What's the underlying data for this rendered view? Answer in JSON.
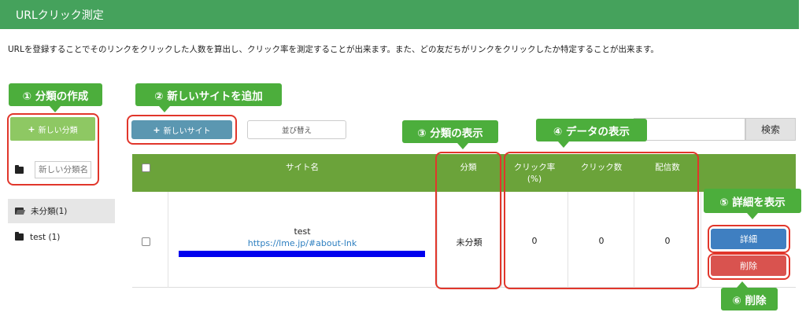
{
  "header": {
    "title": "URLクリック測定"
  },
  "description": "URLを登録することでそのリンクをクリックした人数を算出し、クリック率を測定することが出来ます。また、どの友だちがリンクをクリックしたか特定することが出来ます。",
  "callouts": {
    "c1": "① 分類の作成",
    "c2": "② 新しいサイトを追加",
    "c3": "③ 分類の表示",
    "c4": "④ データの表示",
    "c5": "⑤ 詳細を表示",
    "c6": "⑥ 削除"
  },
  "sidebar": {
    "new_category_label": "新しい分類",
    "category_input_placeholder": "新しい分類名",
    "items": [
      {
        "label": "未分類(1)",
        "active": true
      },
      {
        "label": "test (1)",
        "active": false
      }
    ]
  },
  "toolbar": {
    "new_site_label": "新しいサイト",
    "sort_label": "並び替え",
    "search_label": "検索",
    "search_value": ""
  },
  "table": {
    "headers": {
      "site_name": "サイト名",
      "category": "分類",
      "click_rate": "クリック率",
      "click_rate_unit": "(%)",
      "clicks": "クリック数",
      "deliveries": "配信数"
    },
    "rows": [
      {
        "name": "test",
        "url": "https://lme.jp/#about-lnk",
        "category": "未分類",
        "click_rate": "0",
        "clicks": "0",
        "deliveries": "0",
        "detail_label": "詳細",
        "delete_label": "削除"
      }
    ]
  },
  "colors": {
    "header": "#45a25c",
    "table_header": "#6ba33a",
    "callout": "#4cae3c",
    "highlight": "#e1362b",
    "detail_button": "#3f7fc1",
    "delete_button": "#d9534f"
  }
}
